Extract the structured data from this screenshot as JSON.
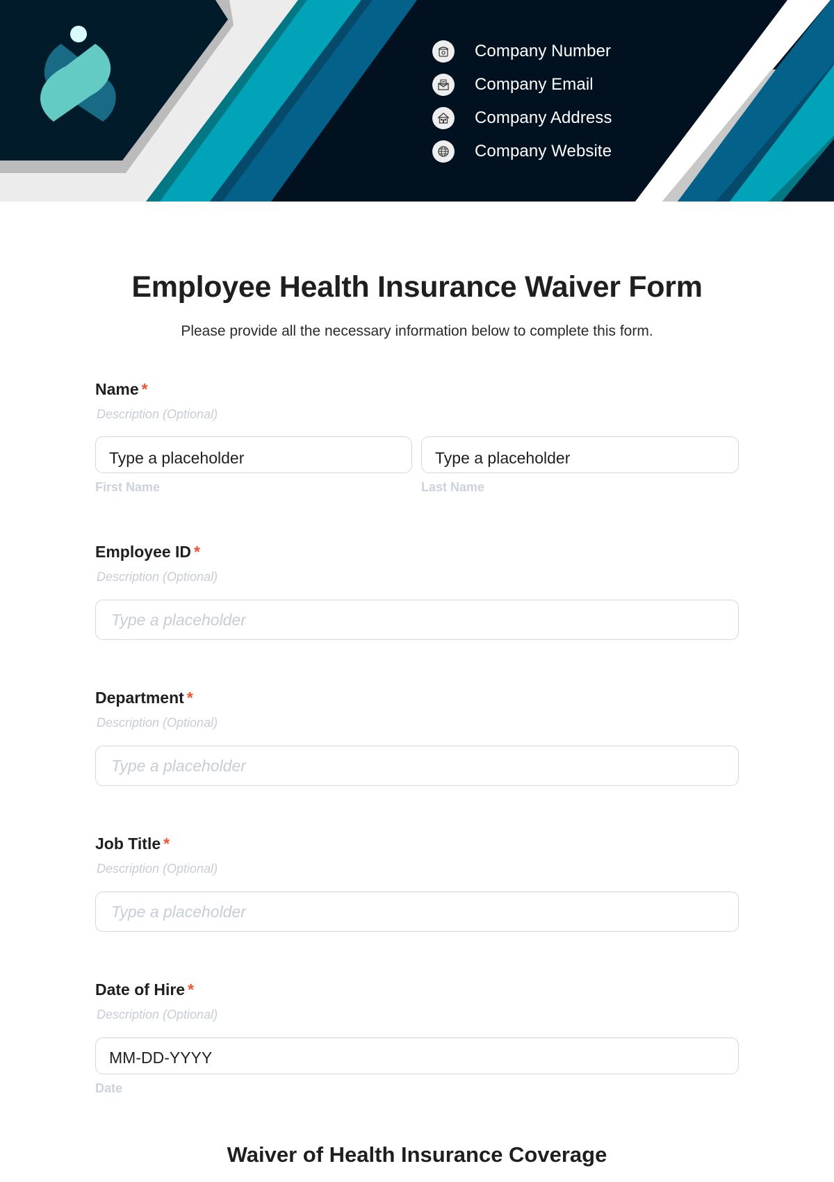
{
  "header": {
    "logo": {
      "name": "company-logo",
      "colors": {
        "dot": "#d8fbfb",
        "leaf_light": "#64cbc4",
        "leaf_dark": "#186a85"
      }
    },
    "contacts": [
      {
        "icon": "phone-icon",
        "label": "Company Number"
      },
      {
        "icon": "email-icon",
        "label": "Company Email"
      },
      {
        "icon": "house-icon",
        "label": "Company Address"
      },
      {
        "icon": "globe-icon",
        "label": "Company Website"
      }
    ],
    "colors": {
      "navy": "#02111f",
      "panel": "#011b2b",
      "light_gray": "#ececec",
      "shadow_gray": "#bcbbbc",
      "teal": "#00a3b7",
      "teal_dark": "#037885",
      "blue": "#04618a",
      "blue_dark": "#064a6b"
    }
  },
  "form": {
    "title": "Employee Health Insurance Waiver Form",
    "subtitle": "Please provide all the necessary information below to complete this form.",
    "required_mark": "*",
    "fields": {
      "name": {
        "label": "Name",
        "description": "Description (Optional)",
        "first": {
          "placeholder": "Type a placeholder",
          "sublabel": "First Name"
        },
        "last": {
          "placeholder": "Type a placeholder",
          "sublabel": "Last Name"
        }
      },
      "employee_id": {
        "label": "Employee ID",
        "description": "Description (Optional)",
        "placeholder": "Type a placeholder"
      },
      "department": {
        "label": "Department",
        "description": "Description (Optional)",
        "placeholder": "Type a placeholder"
      },
      "job_title": {
        "label": "Job Title",
        "description": "Description (Optional)",
        "placeholder": "Type a placeholder"
      },
      "date_of_hire": {
        "label": "Date of Hire",
        "description": "Description (Optional)",
        "placeholder": "MM-DD-YYYY",
        "sublabel": "Date"
      }
    },
    "section_heading": "Waiver of Health Insurance Coverage"
  }
}
